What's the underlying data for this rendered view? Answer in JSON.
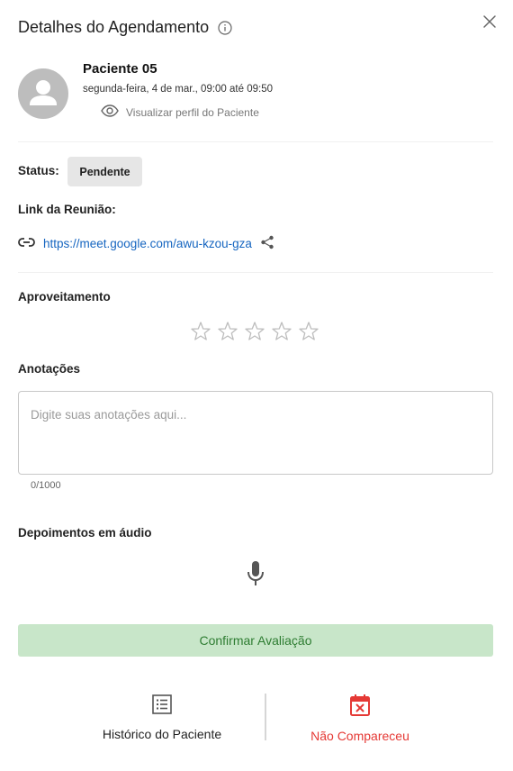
{
  "header": {
    "title": "Detalhes do Agendamento",
    "info_icon": "info-icon",
    "close_icon": "close-icon"
  },
  "patient": {
    "name": "Paciente 05",
    "datetime": "segunda-feira, 4 de mar., 09:00 até 09:50",
    "view_profile_label": "Visualizar perfil do Paciente",
    "view_icon": "eye-icon"
  },
  "status": {
    "label": "Status:",
    "value": "Pendente"
  },
  "meeting": {
    "label": "Link da Reunião:",
    "url": "https://meet.google.com/awu-kzou-gza",
    "link_icon": "link-icon",
    "share_icon": "share-icon"
  },
  "rating": {
    "label": "Aproveitamento",
    "max": 5,
    "value": 0
  },
  "notes": {
    "label": "Anotações",
    "placeholder": "Digite suas anotações aqui...",
    "value": "",
    "counter": "0/1000"
  },
  "audio": {
    "label": "Depoimentos em áudio",
    "mic_icon": "microphone-icon"
  },
  "confirm_label": "Confirmar Avaliação",
  "footer": {
    "history_label": "Histórico do Paciente",
    "no_show_label": "Não Compareceu"
  },
  "colors": {
    "link": "#1565c0",
    "confirm_bg": "#c8e6c9",
    "confirm_text": "#2e7d32",
    "danger": "#e53935",
    "badge_bg": "#e6e6e6"
  }
}
